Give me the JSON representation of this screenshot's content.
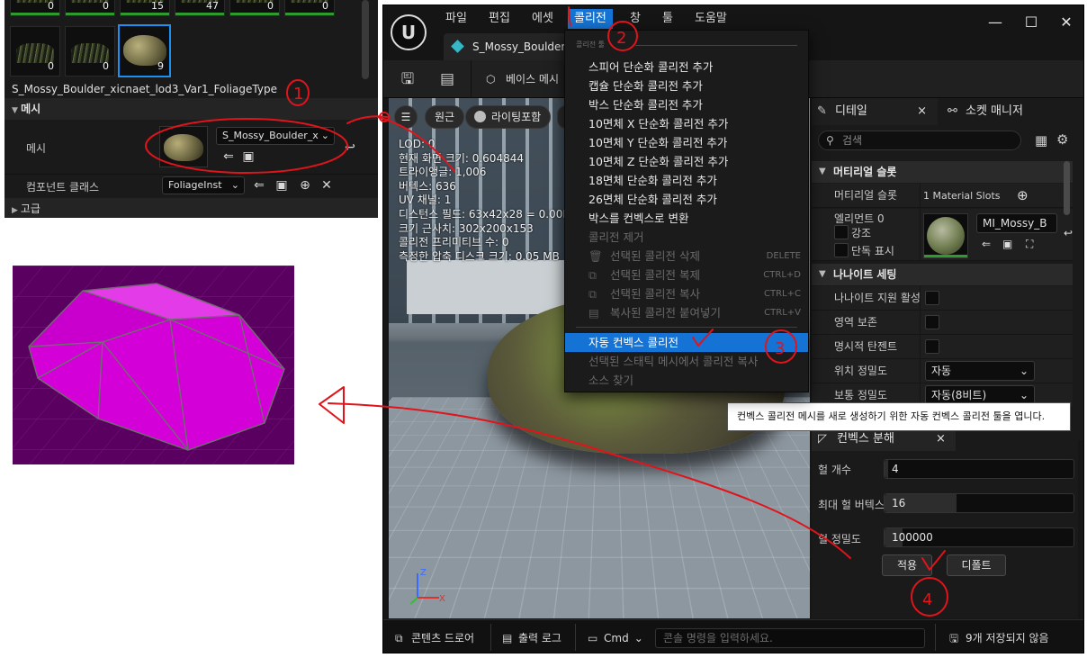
{
  "foliage": {
    "top_counts": [
      "0",
      "0",
      "15",
      "47",
      "0",
      "0"
    ],
    "thumb_counts": [
      "0",
      "0",
      "9"
    ],
    "name": "S_Mossy_Boulder_xicnaet_lod3_Var1_FoliageType",
    "mesh_section": "메시",
    "mesh_label": "메시",
    "mesh_value": "S_Mossy_Boulder_x",
    "component_label": "컴포넌트 클래스",
    "component_value": "FoliageInst",
    "advanced_label": "고급"
  },
  "editor": {
    "menu": [
      "파일",
      "편집",
      "에셋",
      "콜리전",
      "창",
      "툴",
      "도움말"
    ],
    "tab_title": "S_Mossy_Boulder",
    "toolbar": {
      "base_mesh": "베이스 메시"
    },
    "viewport": {
      "perspective": "원근",
      "lighting": "라이팅포함",
      "stats": [
        "LOD: 0",
        "현재 화면 크기: 0.604844",
        "트라이앵글: 1,006",
        "버텍스: 636",
        "UV 채널: 1",
        "디스턴스 필드: 63x42x28 = 0.00M",
        "크기 근사치: 302x200x153",
        "콜리전 프리미티브 수: 0",
        "측정한 압축 디스크 크기: 0.05 MB"
      ]
    }
  },
  "collision_menu": {
    "header": "콜리전 툴",
    "items": [
      "스피어 단순화 콜리전 추가",
      "캡슐 단순화 콜리전 추가",
      "박스 단순화 콜리전 추가",
      "10면체 X 단순화 콜리전 추가",
      "10면체 Y 단순화 콜리전 추가",
      "10면체 Z 단순화 콜리전 추가",
      "18면체 단순화 콜리전 추가",
      "26면체 단순화 콜리전 추가",
      "박스를 컨벡스로 변환"
    ],
    "remove": "콜리전 제거",
    "delete_selected": "선택된 콜리전 삭제",
    "delete_shortcut": "DELETE",
    "duplicate_selected": "선택된 콜리전 복제",
    "duplicate_shortcut": "CTRL+D",
    "copy_selected": "선택된 콜리전 복사",
    "copy_shortcut": "CTRL+C",
    "paste_copied": "복사된 콜리전 붙여넣기",
    "paste_shortcut": "CTRL+V",
    "auto_convex": "자동 컨벡스 콜리전",
    "copy_from_static": "선택된 스태틱 메시에서 콜리전 복사",
    "find_source": "소스 찾기"
  },
  "details": {
    "tab_details": "디테일",
    "tab_socket": "소켓 매니저",
    "search_placeholder": "검색",
    "material_slots_section": "머티리얼 슬롯",
    "material_slots_label": "머티리얼 슬롯",
    "material_slots_value": "1 Material Slots",
    "element_label": "엘리먼트 0",
    "highlight": "강조",
    "isolate": "단독 표시",
    "material_name": "MI_Mossy_B",
    "nanite_section": "나나이트 세팅",
    "nanite_rows": [
      "나나이트 지원 활성",
      "영역 보존",
      "명시적 탄젠트"
    ],
    "position_precision_label": "위치 정밀도",
    "position_precision_value": "자동",
    "normal_precision_label": "보통 정밀도",
    "normal_precision_value": "자동(8비트)"
  },
  "tooltip": "컨벡스 콜리전 메시를 새로 생성하기 위한 자동 컨벡스 콜리전 툴을 엽니다.",
  "convex": {
    "title": "컨벡스 분해",
    "hull_count_label": "헐 개수",
    "hull_count": "4",
    "max_verts_label": "최대 헐 버텍스",
    "max_verts": "16",
    "precision_label": "헐 정밀도",
    "precision": "100000",
    "apply": "적용",
    "defaults": "디폴트"
  },
  "statusbar": {
    "content_drawer": "콘텐츠 드로어",
    "output_log": "출력 로그",
    "cmd": "Cmd",
    "cmd_placeholder": "콘솔 명령을 입력하세요.",
    "unsaved": "9개 저장되지 않음"
  },
  "annotations": [
    "1",
    "2",
    "3",
    "4"
  ],
  "colors": {
    "accent": "#1473d4",
    "annotation": "#e0141a",
    "collision_hull": "#d400d8",
    "collision_bg": "#5a0061"
  }
}
